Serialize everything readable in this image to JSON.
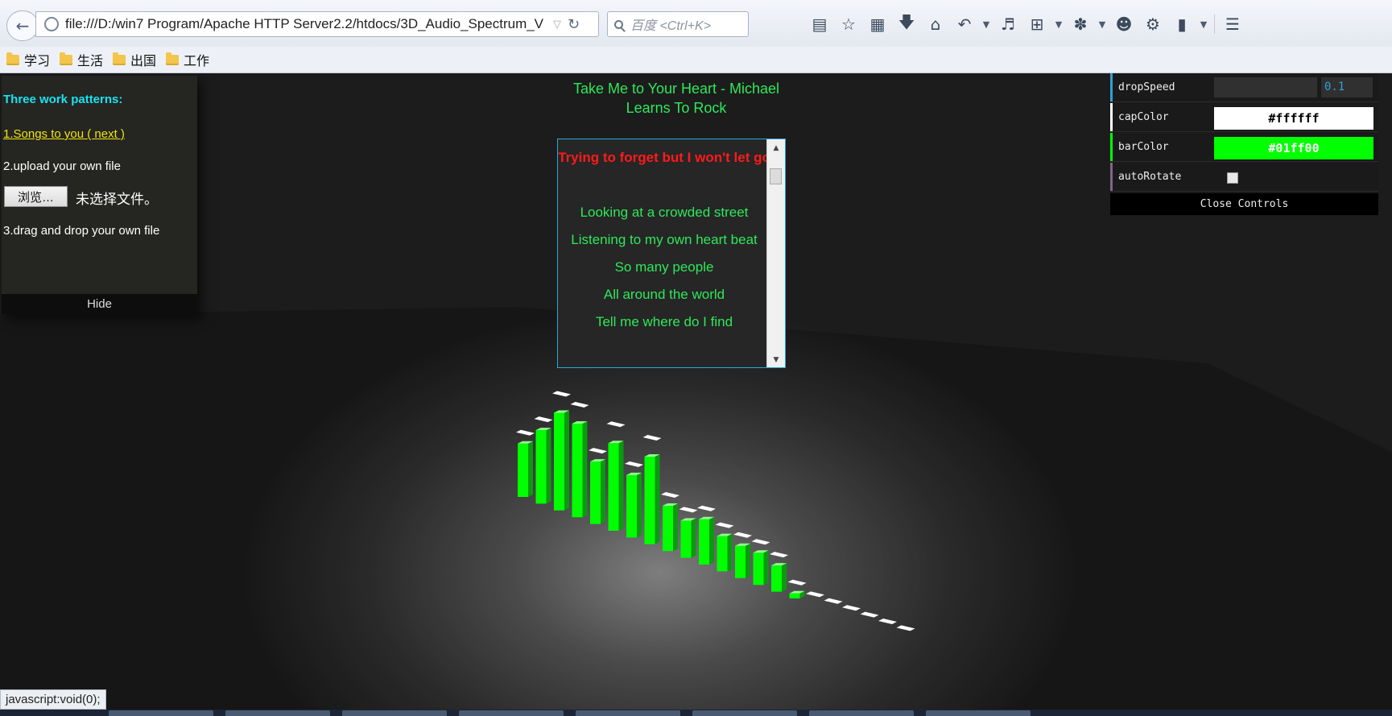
{
  "browser": {
    "url": "file:///D:/win7 Program/Apache HTTP Server2.2/htdocs/3D_Audio_Spectrum_V",
    "search_placeholder": "百度 <Ctrl+K>",
    "toolbar_icons": [
      "bookmarks-menu-icon",
      "star-icon",
      "reader-icon",
      "download-icon",
      "home-icon",
      "undo-icon",
      "sound-icon",
      "crop-icon",
      "bug-icon",
      "chat-icon",
      "extensions-icon",
      "phone-icon",
      "menu-icon"
    ]
  },
  "bookmarks": [
    "学习",
    "生活",
    "出国",
    "工作"
  ],
  "left_panel": {
    "heading": "Three work patterns:",
    "songs_link": "1.Songs to you ( next )",
    "upload_label": "2.upload your own file",
    "browse_button": "浏览…",
    "no_file_text": "未选择文件。",
    "drag_label": "3.drag and drop your own file",
    "hide_button": "Hide"
  },
  "song": {
    "title": "Take Me to Your Heart - Michael Learns To Rock"
  },
  "lyrics": {
    "current": "Trying to forget but I won't let go",
    "lines": [
      "Looking at a crowded street",
      "Listening to my own heart beat",
      "So many people",
      "All around the world",
      "Tell me where do I find"
    ]
  },
  "controls": {
    "drop_speed_label": "dropSpeed",
    "drop_speed_value": "0.1",
    "cap_color_label": "capColor",
    "cap_color_value": "#ffffff",
    "bar_color_label": "barColor",
    "bar_color_value": "#01ff00",
    "auto_rotate_label": "autoRotate",
    "auto_rotate_checked": false,
    "close_button": "Close Controls"
  },
  "colors": {
    "bar": "#01ff00",
    "cap": "#ffffff",
    "heading": "#19e3f0",
    "link": "#f2e50a",
    "lyric": "#2ee85a",
    "lyric_current": "#ff1a1a"
  },
  "spectrum": {
    "bar_levels": [
      0.53,
      0.73,
      0.97,
      0.93,
      0.62,
      0.87,
      0.62,
      0.87,
      0.45,
      0.37,
      0.45,
      0.35,
      0.32,
      0.32,
      0.26,
      0.05,
      0,
      0,
      0,
      0,
      0,
      0
    ]
  },
  "status_text": "javascript:void(0);"
}
